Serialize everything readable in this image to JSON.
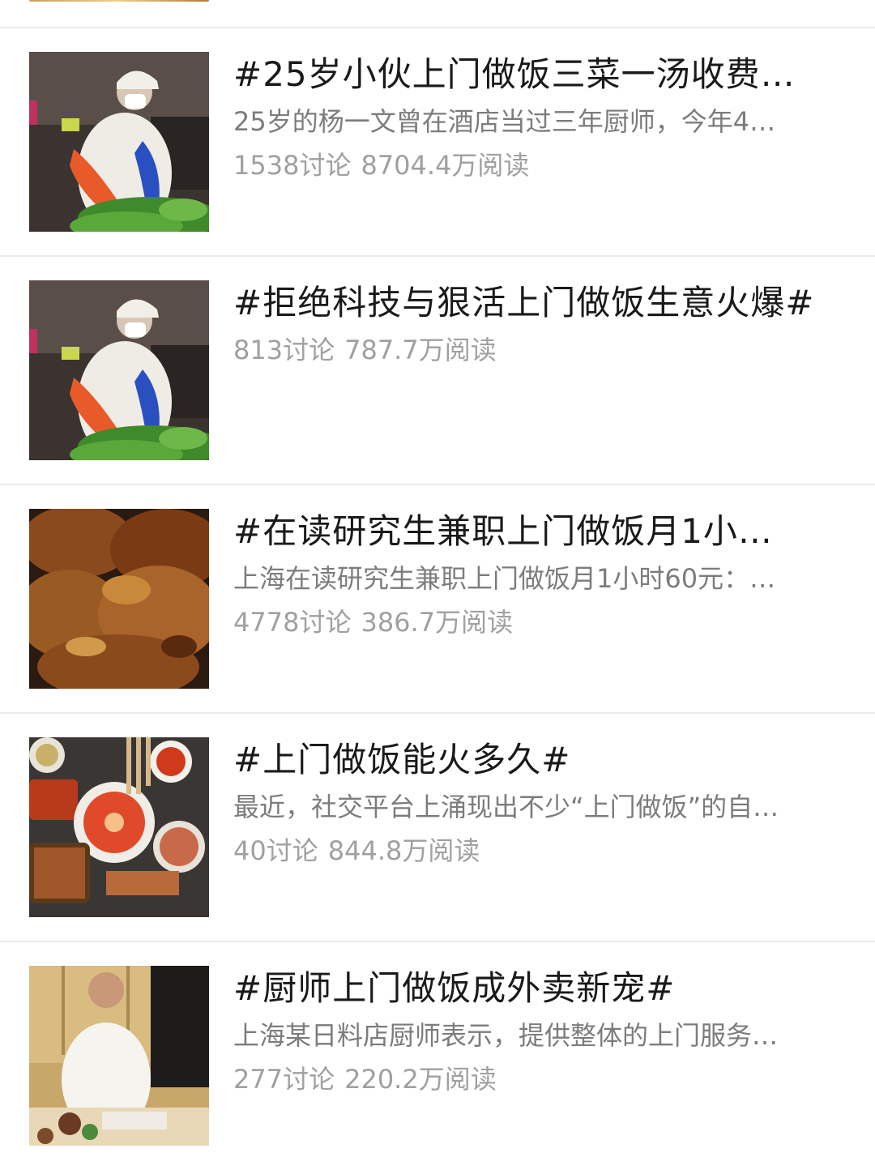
{
  "topics": [
    {
      "title": "#25岁小伙上门做饭三菜一汤收费…",
      "desc": "25岁的杨一文曾在酒店当过三年厨师，今年4…",
      "discussions": "1538讨论",
      "reads": "8704.4万阅读",
      "thumbnail_icon": "chef-at-market-photo"
    },
    {
      "title": "#拒绝科技与狠活上门做饭生意火爆#",
      "desc": "",
      "discussions": "813讨论",
      "reads": "787.7万阅读",
      "thumbnail_icon": "chef-at-market-photo"
    },
    {
      "title": "#在读研究生兼职上门做饭月1小…",
      "desc": "上海在读研究生兼职上门做饭月1小时60元：…",
      "discussions": "4778讨论",
      "reads": "386.7万阅读",
      "thumbnail_icon": "roast-meat-photo"
    },
    {
      "title": "#上门做饭能火多久#",
      "desc": "最近，社交平台上涌现出不少“上门做饭”的自…",
      "discussions": "40讨论",
      "reads": "844.8万阅读",
      "thumbnail_icon": "food-spread-photo"
    },
    {
      "title": "#厨师上门做饭成外卖新宠#",
      "desc": "上海某日料店厨师表示，提供整体的上门服务…",
      "discussions": "277讨论",
      "reads": "220.2万阅读",
      "thumbnail_icon": "chef-kitchen-photo"
    }
  ],
  "colors": {
    "title": "#1a1a1a",
    "desc": "#7c7c7c",
    "stats": "#a0a0a0",
    "divider": "#ececec"
  }
}
